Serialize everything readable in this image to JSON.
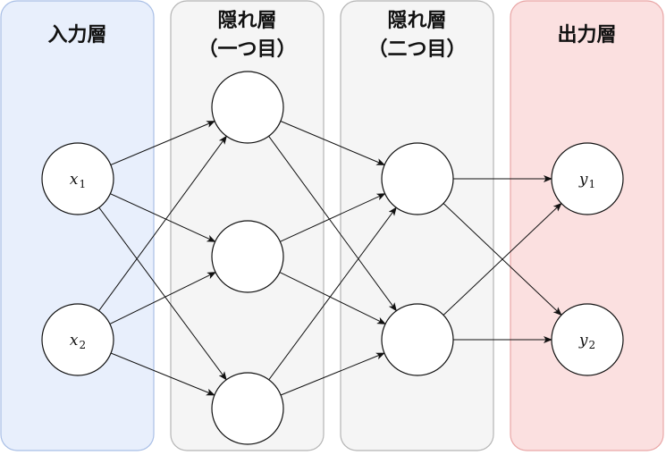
{
  "layers": [
    {
      "title_lines": [
        "入力層"
      ],
      "fill": "#e8effc",
      "stroke": "#a9bfe6",
      "nodes": [
        {
          "label": "x",
          "sub": "1"
        },
        {
          "label": "x",
          "sub": "2"
        }
      ]
    },
    {
      "title_lines": [
        "隠れ層",
        "（一つ目）"
      ],
      "fill": "#f5f5f5",
      "stroke": "#b5b5b5",
      "nodes": [
        {
          "label": "",
          "sub": ""
        },
        {
          "label": "",
          "sub": ""
        },
        {
          "label": "",
          "sub": ""
        }
      ]
    },
    {
      "title_lines": [
        "隠れ層",
        "（二つ目）"
      ],
      "fill": "#f5f5f5",
      "stroke": "#b5b5b5",
      "nodes": [
        {
          "label": "",
          "sub": ""
        },
        {
          "label": "",
          "sub": ""
        }
      ]
    },
    {
      "title_lines": [
        "出力層"
      ],
      "fill": "#fbe0e0",
      "stroke": "#e9a6a6",
      "nodes": [
        {
          "label": "y",
          "sub": "1"
        },
        {
          "label": "y",
          "sub": "2"
        }
      ]
    }
  ],
  "colors": {
    "edge": "#111111",
    "node_fill": "#ffffff",
    "node_stroke": "#111111"
  }
}
